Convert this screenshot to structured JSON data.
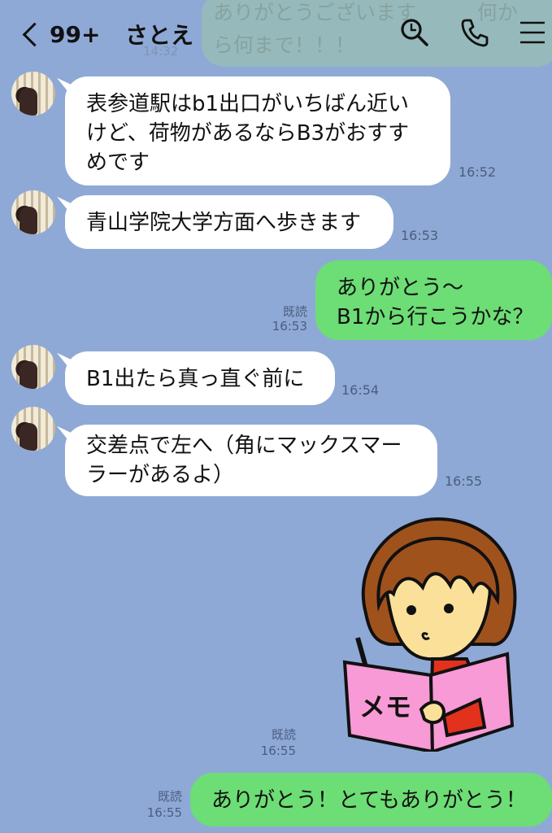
{
  "header": {
    "unread_count": "99+",
    "contact_name": "さとえ",
    "bg_preview_lines": [
      "ありがとうございます　　　何か",
      "ら何まで！！！"
    ],
    "bg_preview_time": "14:32"
  },
  "messages": [
    {
      "side": "in",
      "lines": [
        "表参道駅はb1出口がいちばん近い",
        "けど、荷物があるならB3がおすす",
        "めです"
      ],
      "time": "16:52"
    },
    {
      "side": "in",
      "lines": [
        "青山学院大学方面へ歩きます"
      ],
      "time": "16:53"
    },
    {
      "side": "out",
      "lines": [
        "ありがとう〜",
        "B1から行こうかな？"
      ],
      "read": "既読",
      "time": "16:53"
    },
    {
      "side": "in",
      "lines": [
        "B1出たら真っ直ぐ前に"
      ],
      "time": "16:54"
    },
    {
      "side": "in",
      "lines": [
        "交差点で左へ（角にマックスマー",
        "ラーがあるよ）"
      ],
      "time": "16:55"
    },
    {
      "side": "out",
      "type": "sticker",
      "sticker_text": "メモ",
      "read": "既読",
      "time": "16:55"
    },
    {
      "side": "out",
      "lines": [
        "ありがとう！とてもありがとう！"
      ],
      "read": "既読",
      "time": "16:55"
    }
  ],
  "colors": {
    "background": "#8fa9d6",
    "bubble_out": "#6ddd75",
    "bubble_in": "#ffffff"
  }
}
